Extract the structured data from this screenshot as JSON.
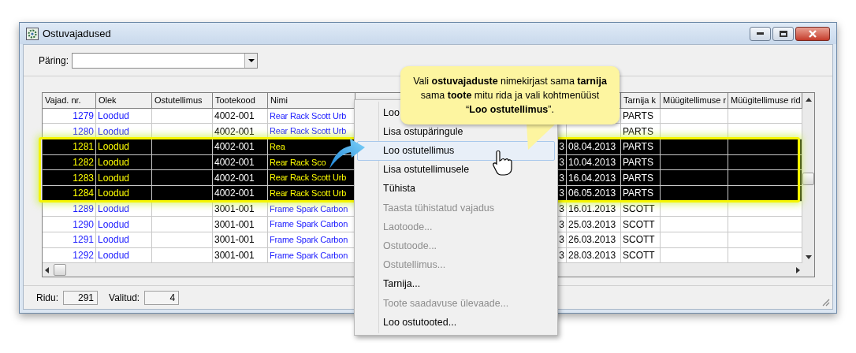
{
  "window": {
    "title": "Ostuvajadused"
  },
  "query": {
    "label": "Päring:"
  },
  "table": {
    "columns": [
      "Vajad. nr.",
      "Olek",
      "Ostutellimus",
      "Tootekood",
      "Nimi"
    ],
    "columns_right": [
      "Tarnija k",
      "Müügitellimuse r",
      "Müügitellimuse rid"
    ],
    "rows": [
      {
        "nr": "1279",
        "olek": "Loodud",
        "tootekood": "4002-001",
        "nimi": "Rear Rack Scott Urb",
        "tarnija": "PARTS",
        "selected": false
      },
      {
        "nr": "1280",
        "olek": "Loodud",
        "tootekood": "4002-001",
        "nimi": "Rear Rack Scott Urb",
        "tarnija": "PARTS",
        "selected": false
      },
      {
        "nr": "1281",
        "olek": "Loodud",
        "tootekood": "4002-001",
        "nimi": "Rea",
        "column_6": "3",
        "date": "08.04.2013",
        "tarnija": "PARTS",
        "selected": true
      },
      {
        "nr": "1282",
        "olek": "Loodud",
        "tootekood": "4002-001",
        "nimi": "Rear Rack Sco",
        "column_6": "3",
        "date": "10.04.2013",
        "tarnija": "PARTS",
        "selected": true
      },
      {
        "nr": "1283",
        "olek": "Loodud",
        "tootekood": "4002-001",
        "nimi": "Rear Rack Scott Urb",
        "column_6": "3",
        "date": "16.04.2013",
        "tarnija": "PARTS",
        "selected": true
      },
      {
        "nr": "1284",
        "olek": "Loodud",
        "tootekood": "4002-001",
        "nimi": "Rear Rack Scott Urb",
        "column_6": "3",
        "date": "06.05.2013",
        "tarnija": "PARTS",
        "selected": true
      },
      {
        "nr": "1289",
        "olek": "Loodud",
        "tootekood": "3001-001",
        "nimi": "Frame Spark Carbon",
        "column_6": "3",
        "date": "16.01.2013",
        "tarnija": "SCOTT",
        "selected": false
      },
      {
        "nr": "1290",
        "olek": "Loodud",
        "tootekood": "3001-001",
        "nimi": "Frame Spark Carbon",
        "column_6": "3",
        "date": "25.03.2013",
        "tarnija": "SCOTT",
        "selected": false
      },
      {
        "nr": "1291",
        "olek": "Loodud",
        "tootekood": "3001-001",
        "nimi": "Frame Spark Carbon",
        "column_6": "3",
        "date": "26.03.2013",
        "tarnija": "SCOTT",
        "selected": false
      },
      {
        "nr": "1292",
        "olek": "Loodud",
        "tootekood": "3001-001",
        "nimi": "Frame Spark Carbon",
        "column_6": "3",
        "date": "28.03.2013",
        "tarnija": "SCOTT",
        "selected": false
      }
    ]
  },
  "status_bar": [
    {
      "label": "Ridu:",
      "value": "291"
    },
    {
      "label": "Valitud:",
      "value": "4"
    }
  ],
  "context_menu": [
    {
      "label": "Loo",
      "disabled": false,
      "selected": false
    },
    {
      "label": "Lisa ostupäringule",
      "disabled": false,
      "selected": false
    },
    {
      "label": "Loo ostutellimus",
      "disabled": false,
      "selected": true
    },
    {
      "label": "Lisa ostutellimusele",
      "disabled": false,
      "selected": false
    },
    {
      "label": "Tühista",
      "disabled": false,
      "selected": false
    },
    {
      "label": "Taasta tühistatud vajadus",
      "disabled": true,
      "selected": false
    },
    {
      "label": "Laotoode...",
      "disabled": true,
      "selected": false
    },
    {
      "label": "Ostutoode...",
      "disabled": true,
      "selected": false
    },
    {
      "label": "Ostutellimus...",
      "disabled": true,
      "selected": false
    },
    {
      "label": "Tarnija...",
      "disabled": false,
      "selected": false
    },
    {
      "label": "Toote saadavuse ülevaade...",
      "disabled": true,
      "selected": false
    },
    {
      "label": "Loo ostutooted...",
      "disabled": false,
      "selected": false
    }
  ],
  "callout": {
    "text": "Vali **ostuvajaduste** nimekirjast sama **tarnija** sama **toote** mitu rida ja vali kohtmenüüst “**Loo ostutellimus**”."
  }
}
